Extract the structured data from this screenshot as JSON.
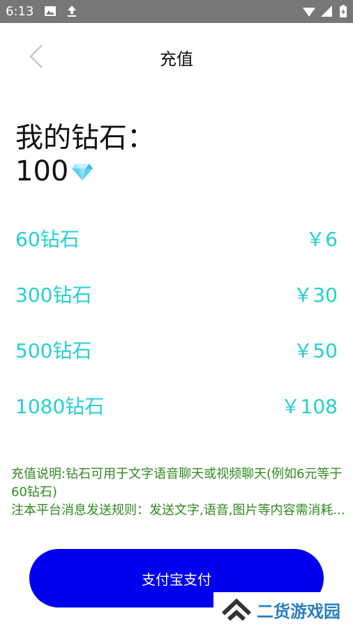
{
  "status_bar": {
    "time": "6:13",
    "icons": [
      "image-icon",
      "upload-icon",
      "wifi-icon",
      "signal-icon",
      "battery-icon"
    ]
  },
  "header": {
    "title": "充值",
    "back_icon": "chevron-left-icon"
  },
  "balance": {
    "label": "我的钻石：",
    "count": "100",
    "icon": "diamond-icon"
  },
  "packages": [
    {
      "label": "60钻石",
      "price": "￥6"
    },
    {
      "label": "300钻石",
      "price": "￥30"
    },
    {
      "label": "500钻石",
      "price": "￥50"
    },
    {
      "label": "1080钻石",
      "price": "￥108"
    }
  ],
  "notes": {
    "line1": "充值说明:钻石可用于文字语音聊天或视频聊天(例如6元等于60钻石)",
    "line2": "注本平台消息发送规则：发送文字,语音,图片等内容需消耗..."
  },
  "pay_button": {
    "label": "支付宝支付"
  },
  "watermark": {
    "text": "二货游戏园"
  },
  "colors": {
    "accent": "#25d0cf",
    "button": "#0000ee",
    "notes": "#2f8a1f",
    "status_bar": "#777777"
  }
}
